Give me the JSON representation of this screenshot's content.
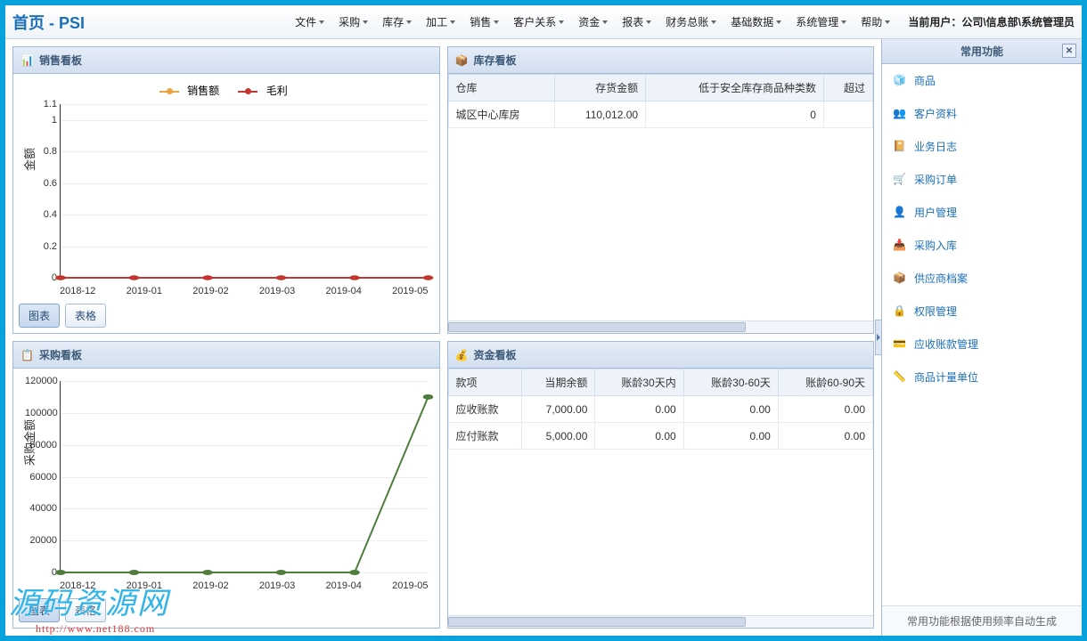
{
  "title": "首页 - PSI",
  "menus": [
    "文件",
    "采购",
    "库存",
    "加工",
    "销售",
    "客户关系",
    "资金",
    "报表",
    "财务总账",
    "基础数据",
    "系统管理",
    "帮助"
  ],
  "user_label": "当前用户：",
  "user_value": "公司\\信息部\\系统管理员",
  "panels": {
    "sales": {
      "title": "销售看板",
      "buttons": [
        "图表",
        "表格"
      ],
      "legend": [
        "销售额",
        "毛利"
      ],
      "ylabel": "金额"
    },
    "inventory": {
      "title": "库存看板",
      "cols": [
        "仓库",
        "存货金额",
        "低于安全库存商品种类数",
        "超过"
      ],
      "rows": [
        [
          "城区中心库房",
          "110,012.00",
          "0",
          ""
        ]
      ]
    },
    "purchase": {
      "title": "采购看板",
      "buttons": [
        "图表",
        "表格"
      ],
      "ylabel": "采购金额"
    },
    "funds": {
      "title": "资金看板",
      "cols": [
        "款项",
        "当期余额",
        "账龄30天内",
        "账龄30-60天",
        "账龄60-90天"
      ],
      "rows": [
        [
          "应收账款",
          "7,000.00",
          "0.00",
          "0.00",
          "0.00"
        ],
        [
          "应付账款",
          "5,000.00",
          "0.00",
          "0.00",
          "0.00"
        ]
      ]
    }
  },
  "right": {
    "title": "常用功能",
    "items": [
      "商品",
      "客户资料",
      "业务日志",
      "采购订单",
      "用户管理",
      "采购入库",
      "供应商档案",
      "权限管理",
      "应收账款管理",
      "商品计量单位"
    ],
    "footer": "常用功能根据使用频率自动生成"
  },
  "watermark": {
    "text": "源码资源网",
    "url": "http://www.net188.com"
  },
  "chart_data": [
    {
      "type": "line",
      "panel": "sales",
      "categories": [
        "2018-12",
        "2019-01",
        "2019-02",
        "2019-03",
        "2019-04",
        "2019-05"
      ],
      "series": [
        {
          "name": "销售额",
          "color": "#e8a33d",
          "values": [
            0,
            0,
            0,
            0,
            0,
            0
          ]
        },
        {
          "name": "毛利",
          "color": "#c23531",
          "values": [
            0,
            0,
            0,
            0,
            0,
            0
          ]
        }
      ],
      "ylabel": "金额",
      "ylim": [
        0,
        1.1
      ],
      "yticks": [
        0,
        0.2,
        0.4,
        0.6,
        0.8,
        1,
        1.1
      ]
    },
    {
      "type": "line",
      "panel": "purchase",
      "categories": [
        "2018-12",
        "2019-01",
        "2019-02",
        "2019-03",
        "2019-04",
        "2019-05"
      ],
      "series": [
        {
          "name": "采购金额",
          "color": "#4f7d3d",
          "values": [
            0,
            0,
            0,
            0,
            0,
            110000
          ]
        }
      ],
      "ylabel": "采购金额",
      "ylim": [
        0,
        120000
      ],
      "yticks": [
        0,
        20000,
        40000,
        60000,
        80000,
        100000,
        120000
      ]
    }
  ]
}
